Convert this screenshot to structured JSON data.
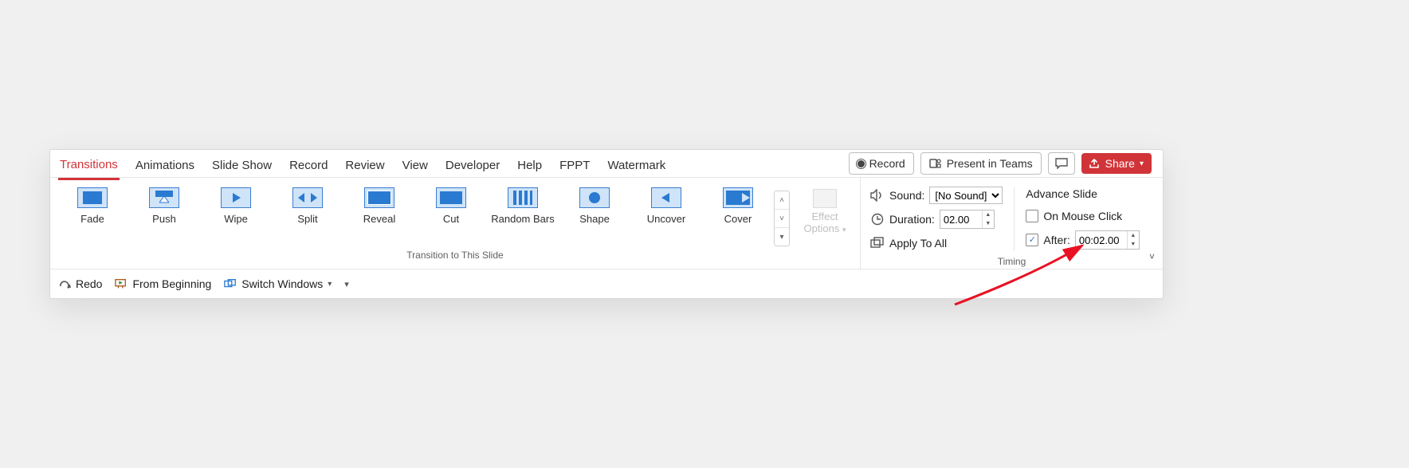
{
  "tabs": {
    "active": "Transitions",
    "items": [
      "Transitions",
      "Animations",
      "Slide Show",
      "Record",
      "Review",
      "View",
      "Developer",
      "Help",
      "FPPT",
      "Watermark"
    ]
  },
  "actions": {
    "record": "Record",
    "present_teams": "Present in Teams",
    "share": "Share"
  },
  "gallery": {
    "group_label": "Transition to This Slide",
    "items": [
      "Fade",
      "Push",
      "Wipe",
      "Split",
      "Reveal",
      "Cut",
      "Random Bars",
      "Shape",
      "Uncover",
      "Cover"
    ],
    "effect_options_label": "Effect Options"
  },
  "timing": {
    "group_label": "Timing",
    "sound_label": "Sound:",
    "sound_value": "[No Sound]",
    "duration_label": "Duration:",
    "duration_value": "02.00",
    "apply_all_label": "Apply To All",
    "advance_slide_label": "Advance Slide",
    "on_mouse_click_label": "On Mouse Click",
    "on_mouse_click_checked": false,
    "after_label": "After:",
    "after_checked": true,
    "after_value": "00:02.00"
  },
  "qat": {
    "redo": "Redo",
    "from_beginning": "From Beginning",
    "switch_windows": "Switch Windows"
  }
}
